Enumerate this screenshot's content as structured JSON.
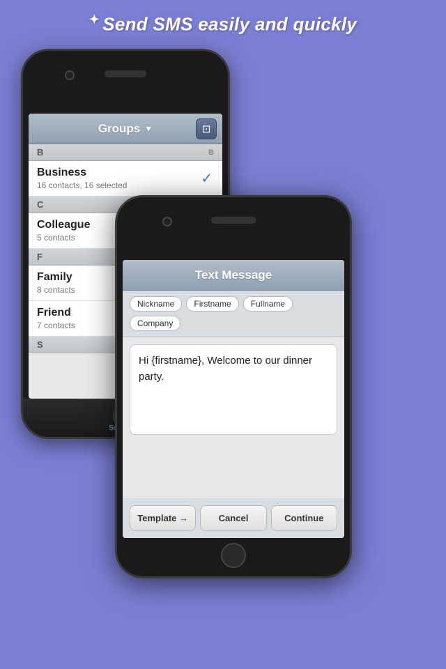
{
  "tagline": {
    "star": "✦",
    "text": "Send SMS easily and quickly"
  },
  "phone1": {
    "nav": {
      "title": "Groups",
      "dropdown_arrow": "▼",
      "compose_icon": "✎"
    },
    "sections": [
      {
        "letter": "B",
        "right_letter": "B",
        "contacts": [
          {
            "name": "Business",
            "sub": "16 contacts, 16 selected",
            "checked": true
          }
        ]
      },
      {
        "letter": "C",
        "contacts": [
          {
            "name": "Colleague",
            "sub": "5 contacts",
            "checked": false
          }
        ]
      },
      {
        "letter": "F",
        "contacts": [
          {
            "name": "Family",
            "sub": "8 contacts",
            "checked": false
          },
          {
            "name": "Friend",
            "sub": "7 contacts",
            "checked": false
          }
        ]
      },
      {
        "letter": "S",
        "contacts": []
      }
    ],
    "tabbar": {
      "icon": "💬",
      "label": "Send SMS"
    }
  },
  "phone2": {
    "nav_title": "Text Message",
    "tokens": [
      "Nickname",
      "Firstname",
      "Fullname",
      "Company"
    ],
    "message": "Hi {firstname}, Welcome to our dinner party.",
    "buttons": {
      "template": "Template →",
      "cancel": "Cancel",
      "continue": "Continue"
    }
  }
}
